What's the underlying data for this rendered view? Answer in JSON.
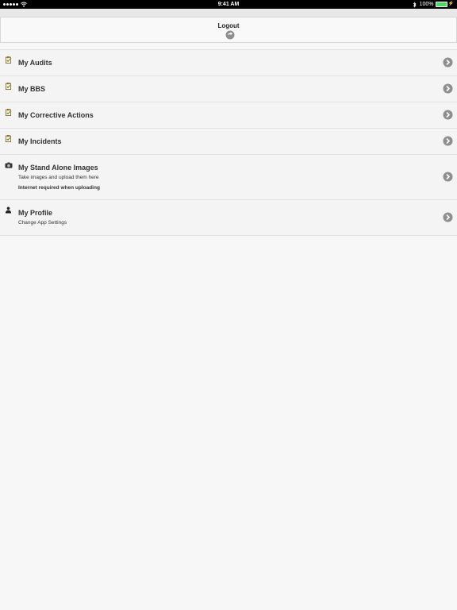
{
  "status_bar": {
    "signal_dots": 5,
    "time": "9:41 AM",
    "battery_percent": "100%",
    "battery_level": 1.0
  },
  "header": {
    "logout_label": "Logout"
  },
  "menu": {
    "items": [
      {
        "title": "My Audits",
        "icon": "clipboard-icon"
      },
      {
        "title": "My BBS",
        "icon": "clipboard-icon"
      },
      {
        "title": "My Corrective Actions",
        "icon": "clipboard-icon"
      },
      {
        "title": "My Incidents",
        "icon": "clipboard-icon"
      },
      {
        "title": "My Stand Alone Images",
        "subtitle": "Take images and upload them here",
        "note": "Internet required when uploading",
        "icon": "camera-icon"
      },
      {
        "title": "My Profile",
        "subtitle": "Change App Settings",
        "icon": "person-icon"
      }
    ]
  },
  "colors": {
    "status_bar": "#000000",
    "battery_green": "#4cd964",
    "background": "#f7f7f7",
    "chevron_gray": "#8e8e8e"
  }
}
